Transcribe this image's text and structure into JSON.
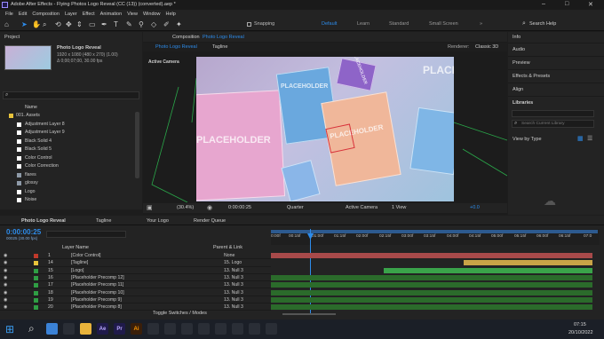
{
  "window": {
    "title": "Adobe After Effects - Flying Photos Logo Reveal (CC (13)) (converted).aep *"
  },
  "menu": [
    "File",
    "Edit",
    "Composition",
    "Layer",
    "Effect",
    "Animation",
    "View",
    "Window",
    "Help"
  ],
  "toolbar": {
    "snapping": "Snapping",
    "workspaces": [
      "Default",
      "Learn",
      "Standard",
      "Small Screen"
    ],
    "search_placeholder": "Search Help"
  },
  "project": {
    "tab": "Project",
    "comp_name": "Photo Logo Reveal",
    "comp_info1": "1920 x 1080  (480 x 270) (1.00)",
    "comp_info2": "Δ 0;00;07;00, 30.00 fps",
    "search_placeholder": "",
    "col_name": "Name",
    "items": [
      {
        "name": "001. Assets",
        "color": "#e8c33b"
      },
      {
        "name": "Adjustment Layer 8",
        "color": "#ffffff"
      },
      {
        "name": "Adjustment Layer 9",
        "color": "#ffffff"
      },
      {
        "name": "Black Solid 4",
        "color": "#ffffff"
      },
      {
        "name": "Black Solid 5",
        "color": "#ffffff"
      },
      {
        "name": "Color Control",
        "color": "#ffffff"
      },
      {
        "name": "Color Correction",
        "color": "#ffffff"
      },
      {
        "name": "flares",
        "color": "#8e9aa8"
      },
      {
        "name": "glossy",
        "color": "#8e9aa8"
      },
      {
        "name": "Logo",
        "color": "#ffffff"
      },
      {
        "name": "Noise",
        "color": "#ffffff"
      }
    ],
    "bpc": "8 bpc"
  },
  "composition": {
    "tab_label": "Composition",
    "tab_name": "Photo Logo Reveal",
    "subtabs": [
      "Photo Logo Reveal",
      "Tagline"
    ],
    "renderer_label": "Renderer:",
    "renderer": "Classic 3D",
    "camera_label": "Active Camera",
    "placeholders": [
      "PLACEHOLDER",
      "PLACEHOLDER",
      "PLACEHOLDER",
      "PLACEHOLDER",
      "PLACE"
    ],
    "viewer": {
      "zoom": "(30.4%)",
      "time": "0:00:00:25",
      "quality": "Quarter",
      "camera": "Active Camera",
      "view": "1 View",
      "exposure": "+0.0"
    }
  },
  "right_panels": {
    "items": [
      "Info",
      "Audio",
      "Preview",
      "Effects & Presets",
      "Align",
      "Libraries"
    ],
    "lib_search": "Search Current Library",
    "view_by": "View by Type"
  },
  "timeline": {
    "tabs": [
      "Photo Logo Reveal",
      "Tagline",
      "Your Logo",
      "Render Queue"
    ],
    "timecode": "0:00:00:25",
    "frames": "00025 (30.00 fps)",
    "col_layer": "Layer Name",
    "col_parent": "Parent & Link",
    "ruler": [
      "0:00f",
      "00:15f",
      "01:00f",
      "01:15f",
      "02:00f",
      "02:15f",
      "03:00f",
      "03:15f",
      "04:00f",
      "04:15f",
      "05:00f",
      "05:15f",
      "06:00f",
      "06:15f",
      "07:0"
    ],
    "toggle_label": "Toggle Switches / Modes",
    "layers": [
      {
        "num": "1",
        "name": "[Color Control]",
        "parent": "None",
        "color": "#c0392b",
        "bar": "#a84a4a",
        "bar_start": 0,
        "bar_end": 1
      },
      {
        "num": "14",
        "name": "[Tagline]",
        "parent": "15. Logo",
        "color": "#e8c33b",
        "bar": "#c9a447",
        "bar_start": 0.6,
        "bar_end": 1
      },
      {
        "num": "15",
        "name": "[Logo]",
        "parent": "13. Null 3",
        "color": "#2f9e44",
        "bar": "#3aa34a",
        "bar_start": 0.35,
        "bar_end": 1
      },
      {
        "num": "16",
        "name": "[Placeholder Precomp 12]",
        "parent": "13. Null 3",
        "color": "#2f9e44",
        "bar": "#2b6b2b",
        "bar_start": 0,
        "bar_end": 1
      },
      {
        "num": "17",
        "name": "[Placeholder Precomp 11]",
        "parent": "13. Null 3",
        "color": "#2f9e44",
        "bar": "#2b6b2b",
        "bar_start": 0,
        "bar_end": 1
      },
      {
        "num": "18",
        "name": "[Placeholder Precomp 10]",
        "parent": "13. Null 3",
        "color": "#2f9e44",
        "bar": "#2b6b2b",
        "bar_start": 0,
        "bar_end": 1
      },
      {
        "num": "19",
        "name": "[Placeholder Precomp 9]",
        "parent": "13. Null 3",
        "color": "#2f9e44",
        "bar": "#2b6b2b",
        "bar_start": 0,
        "bar_end": 1
      },
      {
        "num": "20",
        "name": "[Placeholder Precomp 8]",
        "parent": "13. Null 3",
        "color": "#2f9e44",
        "bar": "#2b6b2b",
        "bar_start": 0,
        "bar_end": 1
      }
    ]
  },
  "taskbar": {
    "time": "07:15",
    "date": "20/10/2022",
    "apps": [
      {
        "label": "",
        "color": "#3b82d6"
      },
      {
        "label": "",
        "color": "#2a2e36"
      },
      {
        "label": "",
        "color": "#e8b33b"
      },
      {
        "label": "Ae",
        "color": "#1f1a4a"
      },
      {
        "label": "Pr",
        "color": "#1f1a4a"
      },
      {
        "label": "Ai",
        "color": "#3a1f0a"
      },
      {
        "label": "",
        "color": "#2a2e36"
      },
      {
        "label": "",
        "color": "#2a2e36"
      },
      {
        "label": "",
        "color": "#2a2e36"
      },
      {
        "label": "",
        "color": "#2a2e36"
      },
      {
        "label": "",
        "color": "#2a2e36"
      },
      {
        "label": "",
        "color": "#2a2e36"
      },
      {
        "label": "",
        "color": "#2a2e36"
      },
      {
        "label": "",
        "color": "#2a2e36"
      }
    ]
  }
}
